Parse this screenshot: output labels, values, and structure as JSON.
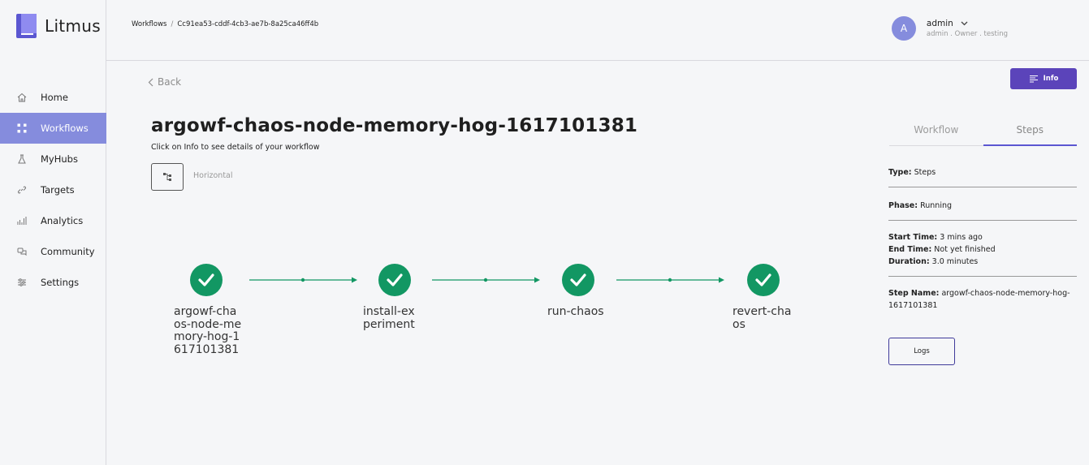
{
  "app": {
    "name": "Litmus"
  },
  "sidebar": {
    "items": [
      {
        "label": "Home",
        "icon": "home-icon"
      },
      {
        "label": "Workflows",
        "icon": "workflows-icon",
        "active": true
      },
      {
        "label": "MyHubs",
        "icon": "flask-icon"
      },
      {
        "label": "Targets",
        "icon": "link-icon"
      },
      {
        "label": "Analytics",
        "icon": "bar-chart-icon"
      },
      {
        "label": "Community",
        "icon": "community-icon"
      },
      {
        "label": "Settings",
        "icon": "sliders-icon"
      }
    ]
  },
  "breadcrumb": {
    "parent": "Workflows",
    "current": "Cc91ea53-cddf-4cb3-ae7b-8a25ca46ff4b"
  },
  "user": {
    "initial": "A",
    "name": "admin",
    "sub": "admin . Owner . testing"
  },
  "back_label": "Back",
  "workflow": {
    "title": "argowf-chaos-node-memory-hog-1617101381",
    "subtitle": "Click on Info to see details of your workflow",
    "orientation": "Horizontal",
    "nodes": [
      {
        "label_lines": [
          "argowf-cha",
          "os-node-me",
          "mory-hog-1",
          "617101381"
        ],
        "status": "Succeeded"
      },
      {
        "label_lines": [
          "install-ex",
          "periment"
        ],
        "status": "Succeeded"
      },
      {
        "label_lines": [
          "run-chaos"
        ],
        "status": "Succeeded"
      },
      {
        "label_lines": [
          "revert-cha",
          "os"
        ],
        "status": "Succeeded"
      }
    ]
  },
  "info_button": "Info",
  "tabs": [
    {
      "label": "Workflow",
      "active": false
    },
    {
      "label": "Steps",
      "active": true
    }
  ],
  "details": {
    "type_label": "Type:",
    "type_value": "Steps",
    "phase_label": "Phase:",
    "phase_value": "Running",
    "start_label": "Start Time:",
    "start_value": "3 mins ago",
    "end_label": "End Time:",
    "end_value": "Not yet finished",
    "duration_label": "Duration:",
    "duration_value": "3.0 minutes",
    "step_label": "Step Name:",
    "step_value": "argowf-chaos-node-memory-hog-1617101381"
  },
  "logs_button": "Logs",
  "colors": {
    "accent": "#5b44ba",
    "sidebar_active": "#858cdd",
    "success": "#129763"
  }
}
